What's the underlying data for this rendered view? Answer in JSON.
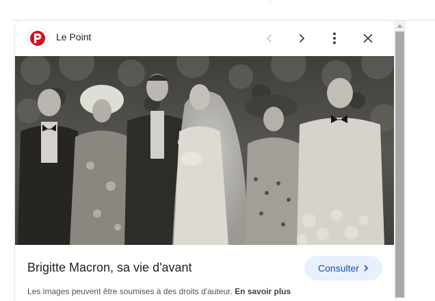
{
  "source": {
    "name": "Le Point",
    "logo_letter": "P"
  },
  "header_icons": {
    "prev": "chevron-left-icon",
    "next": "chevron-right-icon",
    "more": "more-vert-icon",
    "close": "close-icon"
  },
  "image": {
    "subject": "black-and-white wedding photo",
    "lens_icon": "lens-icon"
  },
  "caption": {
    "title": "Brigitte Macron, sa vie d'avant",
    "visit_label": "Consulter",
    "visit_icon": "chevron-right-icon"
  },
  "notice": {
    "text": "Les images peuvent être soumises à des droits d'auteur.",
    "link": "En savoir plus"
  },
  "colors": {
    "brand_red": "#d7101f",
    "visit_bg": "#e8f0fe",
    "visit_text": "#174ea6",
    "title_text": "#202124",
    "icon_gray": "#5f6368",
    "icon_dark": "#3c4043"
  }
}
